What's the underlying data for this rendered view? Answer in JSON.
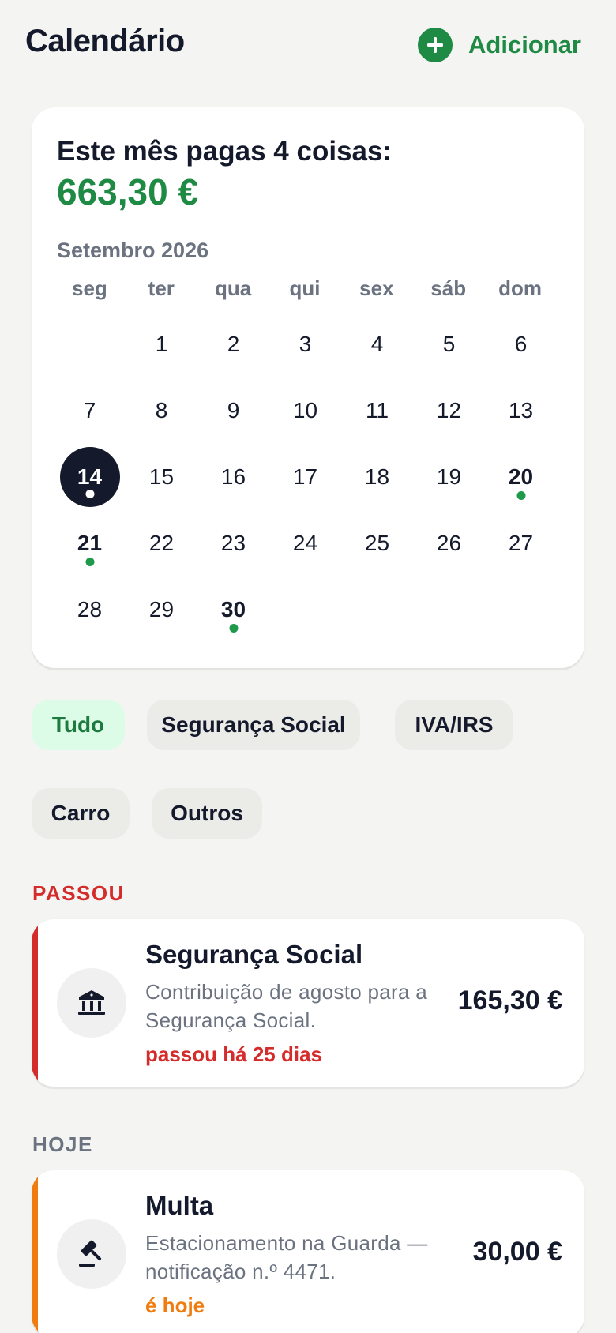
{
  "header": {
    "title": "Calendário",
    "add_label": "Adicionar",
    "add_icon": "plus-circle-icon"
  },
  "summary": {
    "title": "Este mês pagas 4 coisas:",
    "amount": "663,30 €"
  },
  "calendar": {
    "month": "Setembro 2026",
    "weekdays": [
      "seg",
      "ter",
      "qua",
      "qui",
      "sex",
      "sáb",
      "dom"
    ],
    "first_weekday_offset": 1,
    "days_in_month": 30,
    "today": 14,
    "payment_days": [
      14,
      20,
      21,
      30
    ]
  },
  "filters": {
    "chips": [
      {
        "label": "Tudo",
        "active": true
      },
      {
        "label": "Segurança Social",
        "active": false
      },
      {
        "label": "IVA/IRS",
        "active": false
      },
      {
        "label": "Carro",
        "active": false
      },
      {
        "label": "Outros",
        "active": false
      }
    ]
  },
  "sections": [
    {
      "label": "PASSOU",
      "label_color": "#d42b2b",
      "items": [
        {
          "title": "Segurança Social",
          "description": "Contribuição de agosto para a Segurança Social.",
          "status": "passou há 25 dias",
          "status_color": "#d42b2b",
          "accent_color": "#d42b2b",
          "amount": "165,30 €",
          "icon": "bank-icon"
        }
      ]
    },
    {
      "label": "HOJE",
      "label_color": "#6b7280",
      "items": [
        {
          "title": "Multa",
          "description": "Estacionamento na Guarda — notificação n.º 4471.",
          "status": "é hoje",
          "status_color": "#f07c10",
          "accent_color": "#f07c10",
          "amount": "30,00 €",
          "icon": "gavel-icon"
        }
      ]
    }
  ],
  "colors": {
    "brand_green": "#1e8a44",
    "background": "#f4f4f2",
    "dark": "#141a2b"
  }
}
